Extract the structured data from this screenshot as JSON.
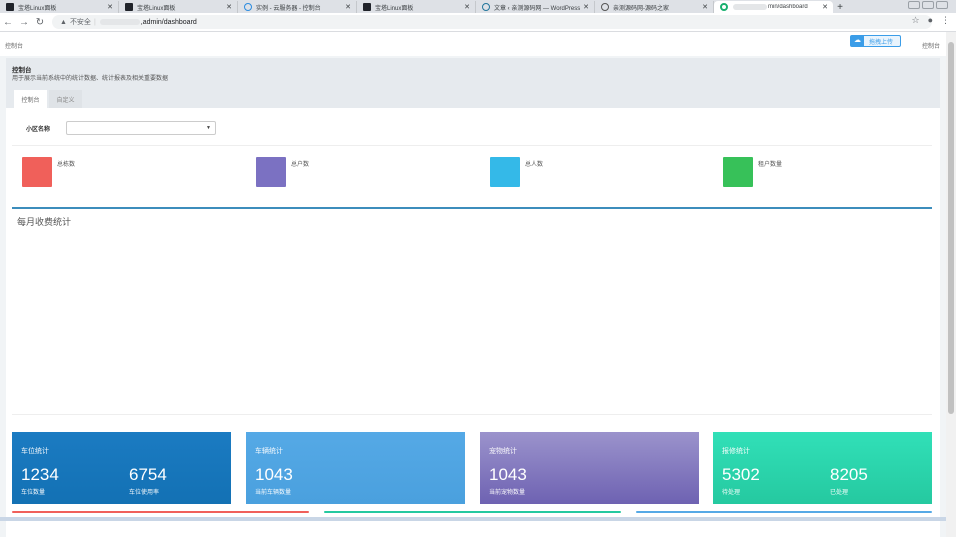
{
  "browser": {
    "tabs": [
      {
        "label": "宝塔Linux面板",
        "favicon": "bt-icon",
        "active": false
      },
      {
        "label": "宝塔Linux面板",
        "favicon": "bt-icon",
        "active": false
      },
      {
        "label": "实例 - 云服务器 - 控制台",
        "favicon": "cloud-icon",
        "active": false
      },
      {
        "label": "宝塔Linux面板",
        "favicon": "bt-icon",
        "active": false
      },
      {
        "label": "文章 ‹ 亲测源码网 — WordPress",
        "favicon": "wordpress-icon",
        "active": false
      },
      {
        "label": "亲测源码网-源码之家",
        "favicon": "globe-icon",
        "active": false
      },
      {
        "label": "min/dashboard",
        "favicon": "site-icon",
        "active": true
      }
    ],
    "address": {
      "security_label": "不安全",
      "url": ",admin/dashboard"
    }
  },
  "topnav": {
    "brand_left": "控制台",
    "brand_right": "控制台",
    "upload_label": "拖拽上传"
  },
  "header": {
    "title": "控制台",
    "description": "用于展示当前系统中的统计数据、统计报表及相关重要数据",
    "tabs": [
      {
        "label": "控制台",
        "active": true
      },
      {
        "label": "自定义",
        "active": false
      }
    ]
  },
  "filter": {
    "label": "小区名称",
    "value": ""
  },
  "stats": [
    {
      "label": "总栋数",
      "color": "#f0605a"
    },
    {
      "label": "总户数",
      "color": "#7b71c2"
    },
    {
      "label": "总人数",
      "color": "#34b9e8"
    },
    {
      "label": "租户数量",
      "color": "#37c159"
    }
  ],
  "chart": {
    "title": "每月收费统计"
  },
  "cards": [
    {
      "title": "车位统计",
      "color_top": "#1b7bc2",
      "color_bottom": "#1371b4",
      "items": [
        {
          "value": "1234",
          "label": "车位数量"
        },
        {
          "value": "6754",
          "label": "车位使用率"
        }
      ]
    },
    {
      "title": "车辆统计",
      "color_top": "#55a9e6",
      "color_bottom": "#4aa0de",
      "items": [
        {
          "value": "1043",
          "label": "当前车辆数量"
        }
      ]
    },
    {
      "title": "宠物统计",
      "color_top": "#9b93cc",
      "color_bottom": "#6e62b2",
      "items": [
        {
          "value": "1043",
          "label": "当前宠物数量"
        }
      ]
    },
    {
      "title": "报修统计",
      "color_top": "#31e0b8",
      "color_bottom": "#25c9a0",
      "items": [
        {
          "value": "5302",
          "label": "待处理"
        },
        {
          "value": "8205",
          "label": "已处理"
        }
      ]
    }
  ],
  "bottom_lines": [
    "#f0605a",
    "#25c9a0",
    "#55a9e6"
  ]
}
